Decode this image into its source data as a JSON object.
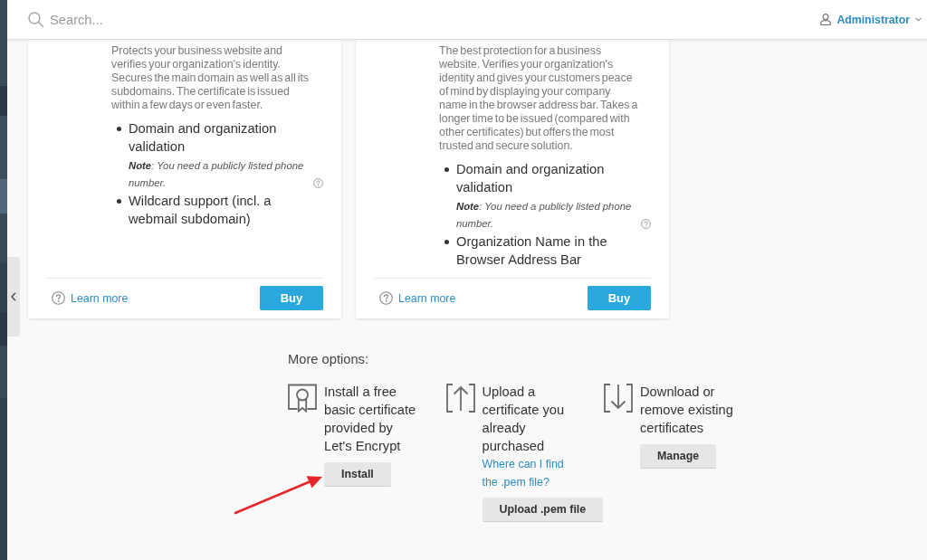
{
  "top_bar": {
    "search": {
      "placeholder": "Search..."
    },
    "user_menu": {
      "label": "Administrator"
    }
  },
  "cards": [
    {
      "description": "Protects your business website and verifies your organization's identity. Secures the main domain as well as all its subdomains. The certificate is issued within a few days or even faster.",
      "features": [
        {
          "text": "Domain and organization validation",
          "note": "**Note**: You need a publicly listed phone number."
        },
        {
          "text": "Wildcard support (incl. a webmail subdomain)"
        }
      ],
      "learn_more": "Learn more",
      "button": "Buy"
    },
    {
      "description": "The best protection for a business website. Verifies your organization's identity and gives your customers peace of mind by displaying your company name in the browser address bar. Takes a longer time to be issued (compared with other certificates) but offers the most trusted and secure solution.",
      "features": [
        {
          "text": "Domain and organization validation",
          "note": "**Note**: You need a publicly listed phone number."
        },
        {
          "text": "Organization Name in the Browser Address Bar"
        }
      ],
      "learn_more": "Learn more",
      "button": "Buy"
    }
  ],
  "more_options": {
    "title": "More options:",
    "options": [
      {
        "kind": "certificate",
        "text": "Install a free basic certificate provided by Let's Encrypt",
        "button": "Install"
      },
      {
        "kind": "upload",
        "text": "Upload a certificate you already purchased",
        "link": "Where can I find the .pem file?",
        "button": "Upload .pem file"
      },
      {
        "kind": "download",
        "text": "Download or remove existing certificates",
        "button": "Manage"
      }
    ]
  }
}
